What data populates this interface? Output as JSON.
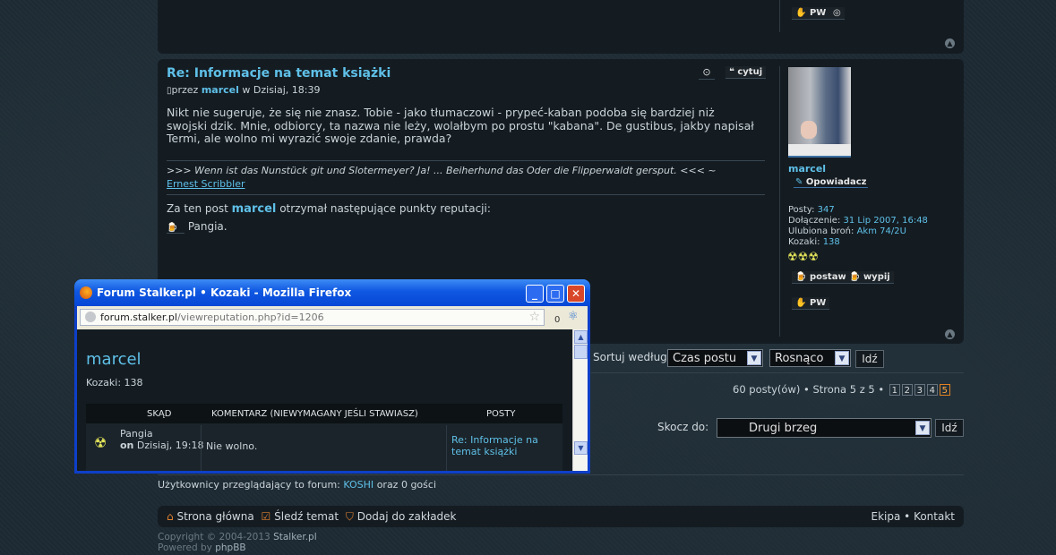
{
  "top_panel": {
    "pw_label": "PW"
  },
  "post": {
    "title": "Re: Informacje na temat książki",
    "by_prefix": "przez",
    "author": "marcel",
    "date": "w Dzisiaj, 18:39",
    "quote_label": "cytuj",
    "body": "Nikt nie sugeruje, że się nie znasz. Tobie - jako tłumaczowi - prypeć-kaban podoba się bardziej niż swojski dzik. Mnie, odbiorcy, ta nazwa nie leży, wolałbym po prostu \"kabana\". De gustibus, jakby napisał Termi, ale wolno mi wyrazić swoje zdanie, prawda?",
    "signature": ">>> Wenn ist das Nunstück git und Slotermeyer? Ja! ... Beiherhund das Oder die Flipperwaldt gersput. <<< ~",
    "signature_link": "Ernest Scribbler",
    "rep_prefix": "Za ten post",
    "rep_user": "marcel",
    "rep_suffix": "otrzymał następujące punkty reputacji:",
    "rep_giver": "Pangia."
  },
  "profile": {
    "username": "marcel",
    "rank": "Opowiadacz",
    "posts_label": "Posty:",
    "posts": "347",
    "joined_label": "Dołączenie:",
    "joined": "31 Lip 2007, 16:48",
    "weapon_label": "Ulubiona broń:",
    "weapon": "Akm 74/2U",
    "kozaki_label": "Kozaki:",
    "kozaki": "138",
    "btn_postaw": "postaw",
    "btn_wypij": "wypij",
    "btn_pw": "PW"
  },
  "sort": {
    "label": "Sortuj według",
    "field": "Czas postu",
    "order": "Rosnąco",
    "go": "Idź"
  },
  "pagination": {
    "text": "60 posty(ów) • Strona 5 z 5 •",
    "pages": [
      "1",
      "2",
      "3",
      "4",
      "5"
    ],
    "current": "5"
  },
  "jump": {
    "label": "Skocz do:",
    "value": "Drugi brzeg",
    "go": "Idź"
  },
  "viewers": {
    "prefix": "Użytkownicy przeglądający to forum:",
    "users": "KOSHI",
    "suffix": "oraz 0 gości"
  },
  "footer": {
    "home": "Strona główna",
    "watch": "Śledź temat",
    "bookmark": "Dodaj do zakładek",
    "team": "Ekipa",
    "sep": "•",
    "contact": "Kontakt",
    "copyright_prefix": "Copyright © 2004-2013",
    "copyright_site": "Stalker.pl",
    "powered_prefix": "Powered by",
    "powered_link": "phpBB"
  },
  "popup": {
    "title": "Forum Stalker.pl • Kozaki - Mozilla Firefox",
    "url_host": "forum.stalker.pl",
    "url_path": "/viewreputation.php?id=1206",
    "counter": "0",
    "username": "marcel",
    "kozaki": "Kozaki: 138",
    "columns": [
      "SKĄD",
      "KOMENTARZ (NIEWYMAGANY JEŚLI STAWIASZ)",
      "POSTY"
    ],
    "row": {
      "from_name": "Pangia",
      "on_word": "on",
      "from_date": "Dzisiaj, 19:18",
      "comment": "Nie wolno.",
      "post": "Re: Informacje na temat książki"
    }
  },
  "colors": {
    "link": "#5fc0e8",
    "bg": "#1d2a33",
    "panel": "#141c22",
    "xp_blue": "#0f57e1"
  }
}
